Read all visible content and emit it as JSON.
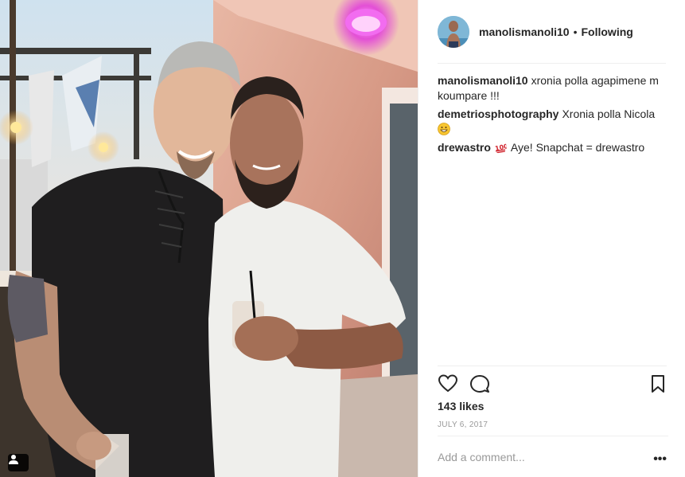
{
  "post": {
    "header": {
      "username": "manolismanoli10",
      "separator": "•",
      "follow_status": "Following"
    },
    "comments": [
      {
        "user": "manolismanoli10",
        "text": "xronia polla agapimene m koumpare !!!",
        "emoji": ""
      },
      {
        "user": "demetriosphotography",
        "text": "Xronia polla Nicola",
        "emoji": "grinning-face"
      },
      {
        "user": "drewastro",
        "text": "Aye! Snapchat = drewastro",
        "emoji": "hundred-points"
      }
    ],
    "likes_text": "143 likes",
    "date_text": "JULY 6, 2017",
    "add_comment_placeholder": "Add a comment...",
    "more_label": "•••"
  },
  "icons": {
    "like": "heart-icon",
    "comment": "comment-bubble-icon",
    "save": "bookmark-icon",
    "tagged": "user-tag-icon",
    "options": "more-options-icon"
  },
  "colors": {
    "text": "#262626",
    "secondary_text": "#999999",
    "divider": "#efefef",
    "lamp_magenta": "#e34fd6"
  }
}
